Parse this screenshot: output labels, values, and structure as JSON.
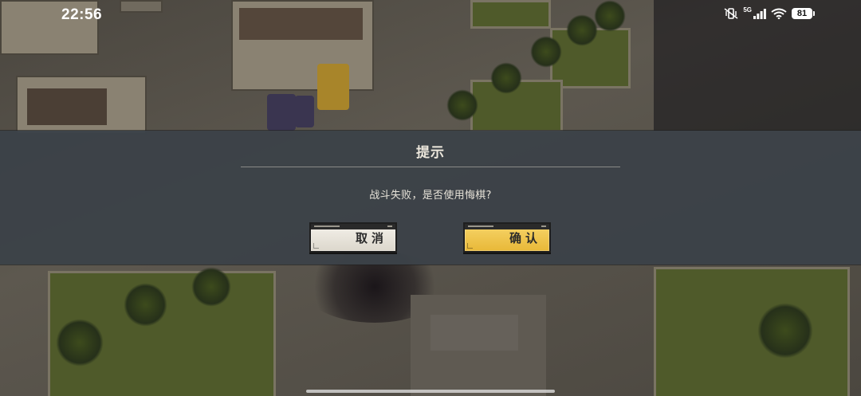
{
  "status_bar": {
    "time": "22:56",
    "network": "5G",
    "battery": "81",
    "icons": [
      "vibrate-mute-icon",
      "cellular-signal-icon",
      "wifi-icon",
      "battery-icon"
    ]
  },
  "dialog": {
    "title": "提示",
    "message": "战斗失败，是否使用悔棋?",
    "cancel_label": "取消",
    "confirm_label": "确认"
  },
  "colors": {
    "dialog_background": "#3c4248",
    "cancel_button": "#ece8df",
    "confirm_button": "#f0c84e",
    "text_light": "#ece7dc",
    "text_dark": "#2b2b2b"
  }
}
